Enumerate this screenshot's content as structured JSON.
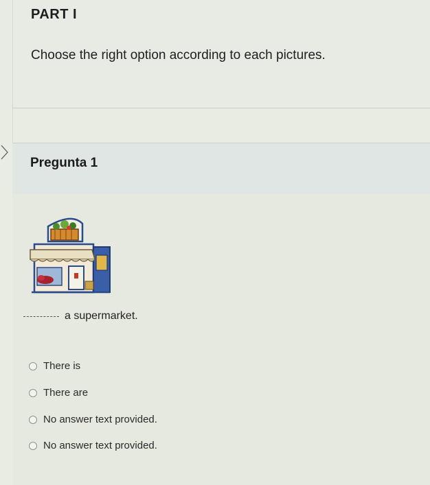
{
  "part": {
    "title": "PART I",
    "instruction": "Choose the right option according to each pictures."
  },
  "question": {
    "title": "Pregunta 1",
    "prompt_blank": "______",
    "prompt_text": "a supermarket.",
    "image_icon": "supermarket-illustration",
    "options": [
      {
        "label": "There is"
      },
      {
        "label": "There are"
      },
      {
        "label": "No answer text provided."
      },
      {
        "label": "No answer text provided."
      }
    ]
  }
}
